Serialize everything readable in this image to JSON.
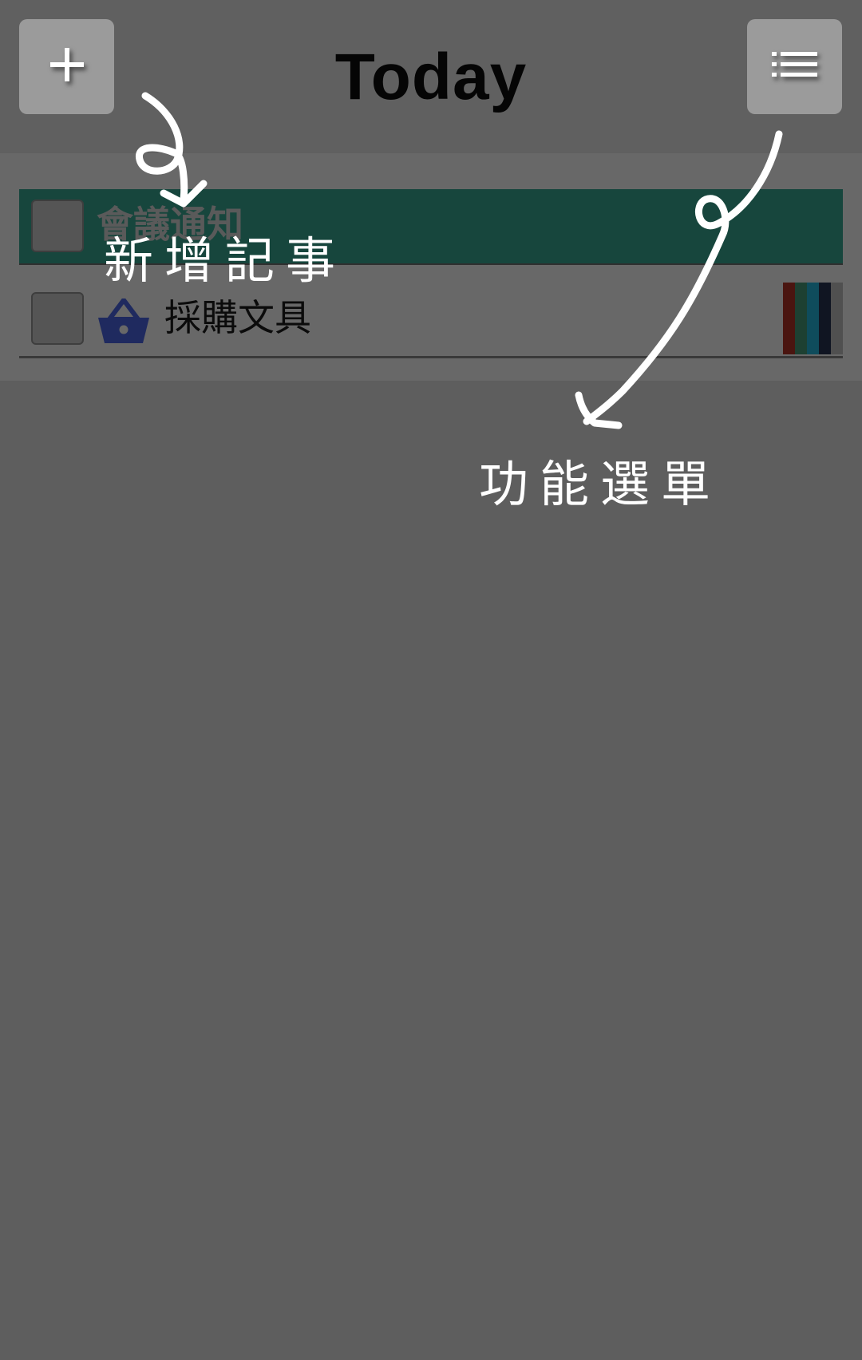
{
  "header": {
    "title": "Today",
    "add_icon": "plus-icon",
    "menu_icon": "list-icon"
  },
  "items": [
    {
      "label": "會議通知",
      "checked": false,
      "highlight_color": "#17463d"
    },
    {
      "label": "採購文具",
      "checked": false,
      "icon": "shopping-basket-icon",
      "icon_color": "#1f2a5f",
      "color_swatches": [
        "#4a1510",
        "#1d4032",
        "#0f4c5c",
        "#101522",
        "#505050"
      ]
    }
  ],
  "annotations": {
    "add_note": "新增記事",
    "menu_note": "功能選單"
  }
}
